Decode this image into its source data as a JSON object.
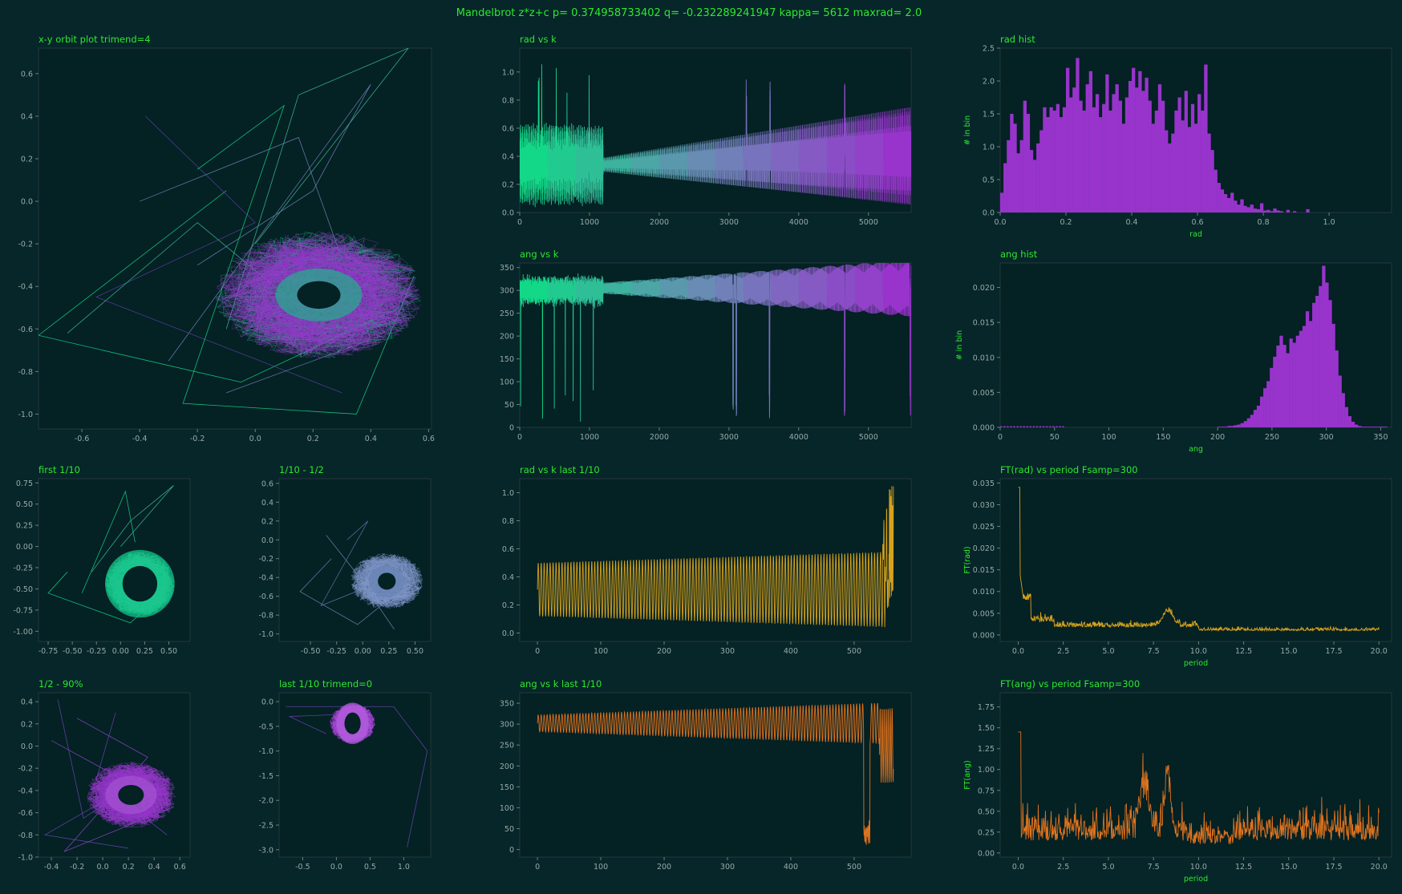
{
  "colors": {
    "background": "#062629",
    "axes_face": "#042124",
    "title_text": "#2ee82e",
    "tick_text": "#9aaaa8",
    "green": "#13d888",
    "blue": "#6f86b8",
    "purple": "#9834cc",
    "gold": "#d6a21c",
    "orange": "#e0731d"
  },
  "chart_data": {
    "suptitle": "Mandelbrot z*z+c  p= 0.374958733402  q= -0.232289241947  kappa= 5612  maxrad= 2.0",
    "panels": [
      {
        "id": "xy",
        "title": "x-y orbit plot  trimend=4",
        "type": "line",
        "xlim": [
          -0.75,
          0.61
        ],
        "ylim": [
          -1.07,
          0.72
        ],
        "xticks": [
          "-0.6",
          "-0.4",
          "-0.2",
          "0.0",
          "0.2",
          "0.4",
          "0.6"
        ],
        "xtick_values": [
          -0.6,
          -0.4,
          -0.2,
          0,
          0.2,
          0.4,
          0.6
        ],
        "yticks": [
          "-1.0",
          "-0.8",
          "-0.6",
          "-0.4",
          "-0.2",
          "0.0",
          "0.2",
          "0.4",
          "0.6"
        ],
        "ytick_values": [
          -1.0,
          -0.8,
          -0.6,
          -0.4,
          -0.2,
          0,
          0.2,
          0.4,
          0.6
        ],
        "orbit": {
          "cx": 0.22,
          "cy": -0.44,
          "rx_in": 0.075,
          "ry_in": 0.065,
          "rx_out": 0.36,
          "ry_out": 0.3
        }
      },
      {
        "id": "radk",
        "title": "rad vs k",
        "type": "line",
        "xlim": [
          0,
          5612
        ],
        "ylim": [
          0,
          1.17
        ],
        "xticks": [
          "0",
          "1000",
          "2000",
          "3000",
          "4000",
          "5000"
        ],
        "xtick_values": [
          0,
          1000,
          2000,
          3000,
          4000,
          5000
        ],
        "yticks": [
          "0.0",
          "0.2",
          "0.4",
          "0.6",
          "0.8",
          "1.0"
        ],
        "ytick_values": [
          0,
          0.2,
          0.4,
          0.6,
          0.8,
          1.0
        ]
      },
      {
        "id": "radhist",
        "title": "rad hist",
        "type": "bar",
        "xlabel": "rad",
        "ylabel": "# in bin",
        "xlim": [
          0,
          1.19
        ],
        "ylim": [
          0,
          2.5
        ],
        "xticks": [
          "0.0",
          "0.2",
          "0.4",
          "0.6",
          "0.8",
          "1.0"
        ],
        "xtick_values": [
          0,
          0.2,
          0.4,
          0.6,
          0.8,
          1.0
        ],
        "yticks": [
          "0.0",
          "0.5",
          "1.0",
          "1.5",
          "2.0",
          "2.5"
        ],
        "ytick_values": [
          0,
          0.5,
          1.0,
          1.5,
          2.0,
          2.5
        ],
        "bin_width": 0.01,
        "values": [
          0.3,
          0.75,
          1.1,
          1.5,
          1.35,
          0.9,
          1.1,
          1.7,
          1.5,
          0.95,
          0.8,
          1.05,
          1.25,
          1.6,
          1.45,
          1.6,
          1.55,
          1.65,
          1.45,
          1.6,
          2.2,
          1.75,
          1.9,
          2.35,
          1.7,
          1.55,
          1.95,
          2.15,
          1.6,
          1.8,
          1.45,
          1.65,
          2.1,
          1.55,
          1.8,
          1.95,
          1.7,
          1.35,
          1.75,
          2.0,
          2.2,
          1.9,
          2.15,
          1.85,
          2.05,
          1.7,
          1.35,
          1.55,
          1.95,
          1.7,
          1.25,
          1.05,
          1.2,
          1.55,
          1.75,
          1.4,
          1.85,
          1.3,
          1.65,
          1.35,
          1.8,
          1.55,
          2.25,
          1.2,
          0.95,
          0.65,
          0.45,
          0.35,
          0.28,
          0.22,
          0.3,
          0.18,
          0.12,
          0.2,
          0.1,
          0.08,
          0.12,
          0.06,
          0.05,
          0.14,
          0.03,
          0.04,
          0.02,
          0.06,
          0.03,
          0.02,
          0.0,
          0.04,
          0.0,
          0.02,
          0.0,
          0.0,
          0.0,
          0.05,
          0.0,
          0.0,
          0.0,
          0.0,
          0.0,
          0.0,
          0.0,
          0.0,
          0.0,
          0.0,
          0.0,
          0.0,
          0.0,
          0.0,
          0.0,
          0.0,
          0.0,
          0.0,
          0.0,
          0.0,
          0.0,
          0.0,
          0.0,
          0.0,
          0.0,
          0.0
        ]
      },
      {
        "id": "angk",
        "title": "ang vs k",
        "type": "line",
        "xlim": [
          0,
          5612
        ],
        "ylim": [
          0,
          360
        ],
        "xticks": [
          "0",
          "1000",
          "2000",
          "3000",
          "4000",
          "5000"
        ],
        "xtick_values": [
          0,
          1000,
          2000,
          3000,
          4000,
          5000
        ],
        "yticks": [
          "0",
          "50",
          "100",
          "150",
          "200",
          "250",
          "300",
          "350"
        ],
        "ytick_values": [
          0,
          50,
          100,
          150,
          200,
          250,
          300,
          350
        ]
      },
      {
        "id": "anghist",
        "title": "ang hist",
        "type": "bar",
        "xlabel": "ang",
        "ylabel": "# in bin",
        "xlim": [
          0,
          360
        ],
        "ylim": [
          0,
          0.0235
        ],
        "xticks": [
          "0",
          "50",
          "100",
          "150",
          "200",
          "250",
          "300",
          "350"
        ],
        "xtick_values": [
          0,
          50,
          100,
          150,
          200,
          250,
          300,
          350
        ],
        "yticks": [
          "0.000",
          "0.005",
          "0.010",
          "0.015",
          "0.020"
        ],
        "ytick_values": [
          0,
          0.005,
          0.01,
          0.015,
          0.02
        ],
        "bin_start": 200,
        "bin_width": 3,
        "values": [
          0.0001,
          0.0001,
          0.0001,
          0.0002,
          0.0002,
          0.0003,
          0.0004,
          0.0006,
          0.0009,
          0.0013,
          0.0018,
          0.0025,
          0.0031,
          0.0044,
          0.0056,
          0.0066,
          0.0085,
          0.0101,
          0.0117,
          0.0131,
          0.0118,
          0.0106,
          0.0127,
          0.0121,
          0.0131,
          0.0138,
          0.0145,
          0.0166,
          0.0152,
          0.0178,
          0.0188,
          0.0202,
          0.0231,
          0.0207,
          0.0182,
          0.0148,
          0.011,
          0.0074,
          0.0049,
          0.0029,
          0.0016,
          0.0008,
          0.0004,
          0.0002,
          0.0001,
          0.0001,
          0.0001,
          0.0001,
          0.0001,
          0.0001,
          0.0001,
          0.0001
        ]
      },
      {
        "id": "first",
        "title": "first 1/10",
        "type": "line",
        "xlim": [
          -0.85,
          0.72
        ],
        "ylim": [
          -1.12,
          0.8
        ],
        "xticks": [
          "-0.75",
          "-0.50",
          "-0.25",
          "0.00",
          "0.25",
          "0.50"
        ],
        "xtick_values": [
          -0.75,
          -0.5,
          -0.25,
          0,
          0.25,
          0.5
        ],
        "yticks": [
          "-1.00",
          "-0.75",
          "-0.50",
          "-0.25",
          "0.00",
          "0.25",
          "0.50",
          "0.75"
        ],
        "ytick_values": [
          -1.0,
          -0.75,
          -0.5,
          -0.25,
          0,
          0.25,
          0.5,
          0.75
        ],
        "orbit": {
          "cx": 0.2,
          "cy": -0.44,
          "rx_in": 0.18,
          "ry_in": 0.21,
          "rx_out": 0.36,
          "ry_out": 0.38
        }
      },
      {
        "id": "tenth",
        "title": "1/10 - 1/2",
        "type": "line",
        "xlim": [
          -0.8,
          0.65
        ],
        "ylim": [
          -1.08,
          0.65
        ],
        "xticks": [
          "-0.50",
          "-0.25",
          "0.00",
          "0.25",
          "0.50"
        ],
        "xtick_values": [
          -0.5,
          -0.25,
          0,
          0.25,
          0.5
        ],
        "yticks": [
          "-1.0",
          "-0.8",
          "-0.6",
          "-0.4",
          "-0.2",
          "0.0",
          "0.2",
          "0.4",
          "0.6"
        ],
        "ytick_values": [
          -1.0,
          -0.8,
          -0.6,
          -0.4,
          -0.2,
          0,
          0.2,
          0.4,
          0.6
        ],
        "orbit": {
          "cx": 0.23,
          "cy": -0.44,
          "rx_in": 0.085,
          "ry_in": 0.09,
          "rx_out": 0.35,
          "ry_out": 0.3
        }
      },
      {
        "id": "radlast",
        "title": "rad vs k last 1/10",
        "type": "line",
        "xlim": [
          -28,
          590
        ],
        "ylim": [
          -0.06,
          1.1
        ],
        "xticks": [
          "0",
          "100",
          "200",
          "300",
          "400",
          "500"
        ],
        "xtick_values": [
          0,
          100,
          200,
          300,
          400,
          500
        ],
        "yticks": [
          "0.0",
          "0.2",
          "0.4",
          "0.6",
          "0.8",
          "1.0"
        ],
        "ytick_values": [
          0,
          0.2,
          0.4,
          0.6,
          0.8,
          1.0
        ]
      },
      {
        "id": "ftrad",
        "title": "FT(rad) vs period   Fsamp=300",
        "type": "line",
        "xlabel": "period",
        "ylabel": "FT(rad)",
        "xlim": [
          -1,
          20.7
        ],
        "ylim": [
          -0.0015,
          0.036
        ],
        "xticks": [
          "0.0",
          "2.5",
          "5.0",
          "7.5",
          "10.0",
          "12.5",
          "15.0",
          "17.5",
          "20.0"
        ],
        "xtick_values": [
          0,
          2.5,
          5,
          7.5,
          10,
          12.5,
          15,
          17.5,
          20
        ],
        "yticks": [
          "0.000",
          "0.005",
          "0.010",
          "0.015",
          "0.020",
          "0.025",
          "0.030",
          "0.035"
        ],
        "ytick_values": [
          0,
          0.005,
          0.01,
          0.015,
          0.02,
          0.025,
          0.03,
          0.035
        ]
      },
      {
        "id": "half",
        "title": "1/2 - 90%",
        "type": "line",
        "xlim": [
          -0.5,
          0.68
        ],
        "ylim": [
          -1.0,
          0.48
        ],
        "xticks": [
          "-0.4",
          "-0.2",
          "0.0",
          "0.2",
          "0.4",
          "0.6"
        ],
        "xtick_values": [
          -0.4,
          -0.2,
          0,
          0.2,
          0.4,
          0.6
        ],
        "yticks": [
          "-1.0",
          "-0.8",
          "-0.6",
          "-0.4",
          "-0.2",
          "0.0",
          "0.2",
          "0.4"
        ],
        "ytick_values": [
          -1.0,
          -0.8,
          -0.6,
          -0.4,
          -0.2,
          0,
          0.2,
          0.4
        ],
        "orbit": {
          "cx": 0.22,
          "cy": -0.44,
          "rx_in": 0.1,
          "ry_in": 0.09,
          "rx_out": 0.35,
          "ry_out": 0.3
        }
      },
      {
        "id": "last",
        "title": "last 1/10  trimend=0",
        "type": "line",
        "xlim": [
          -0.85,
          1.4
        ],
        "ylim": [
          -3.15,
          0.18
        ],
        "xticks": [
          "-0.5",
          "0.0",
          "0.5",
          "1.0"
        ],
        "xtick_values": [
          -0.5,
          0,
          0.5,
          1.0
        ],
        "yticks": [
          "-3.0",
          "-2.5",
          "-2.0",
          "-1.5",
          "-1.0",
          "-0.5",
          "0.0"
        ],
        "ytick_values": [
          -3.0,
          -2.5,
          -2.0,
          -1.5,
          -1.0,
          -0.5,
          0
        ],
        "orbit": {
          "cx": 0.24,
          "cy": -0.44,
          "rx_in": 0.12,
          "ry_in": 0.22,
          "rx_out": 0.34,
          "ry_out": 0.4
        }
      },
      {
        "id": "anglast",
        "title": "ang vs k last 1/10",
        "type": "line",
        "xlim": [
          -28,
          590
        ],
        "ylim": [
          -18,
          375
        ],
        "xticks": [
          "0",
          "100",
          "200",
          "300",
          "400",
          "500"
        ],
        "xtick_values": [
          0,
          100,
          200,
          300,
          400,
          500
        ],
        "yticks": [
          "0",
          "50",
          "100",
          "150",
          "200",
          "250",
          "300",
          "350"
        ],
        "ytick_values": [
          0,
          50,
          100,
          150,
          200,
          250,
          300,
          350
        ]
      },
      {
        "id": "ftang",
        "title": "FT(ang) vs period   Fsamp=300",
        "type": "line",
        "xlabel": "period",
        "ylabel": "FT(ang)",
        "xlim": [
          -1,
          20.7
        ],
        "ylim": [
          -0.05,
          1.92
        ],
        "xticks": [
          "0.0",
          "2.5",
          "5.0",
          "7.5",
          "10.0",
          "12.5",
          "15.0",
          "17.5",
          "20.0"
        ],
        "xtick_values": [
          0,
          2.5,
          5,
          7.5,
          10,
          12.5,
          15,
          17.5,
          20
        ],
        "yticks": [
          "0.00",
          "0.25",
          "0.50",
          "0.75",
          "1.00",
          "1.25",
          "1.50",
          "1.75"
        ],
        "ytick_values": [
          0,
          0.25,
          0.5,
          0.75,
          1.0,
          1.25,
          1.5,
          1.75
        ]
      }
    ]
  }
}
